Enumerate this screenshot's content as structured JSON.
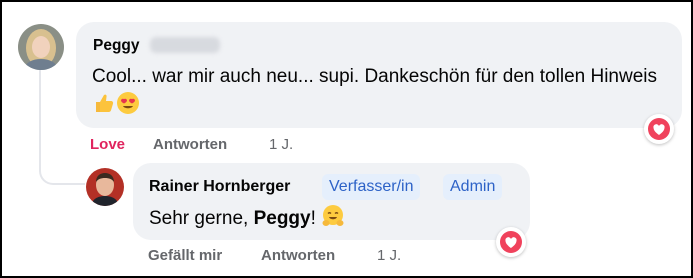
{
  "comments": [
    {
      "author": "Peggy",
      "text": "Cool... war mir auch neu... supi. Dankeschön für den tollen Hinweis",
      "emojis": [
        "thumbs-up-emoji",
        "smiling-face-with-heart-eyes-emoji"
      ],
      "actions": {
        "reaction_label": "Love",
        "reply_label": "Antworten",
        "time": "1 J."
      },
      "reaction_icon": "heart-icon",
      "colors": {
        "reaction_text": "#e0245e",
        "heart": "#f0425c"
      }
    },
    {
      "author": "Rainer Hornberger",
      "badges": [
        "Verfasser/in",
        "Admin"
      ],
      "text_before": "Sehr gerne, ",
      "mention": "Peggy",
      "text_after": "!",
      "emojis": [
        "hugging-face-emoji"
      ],
      "actions": {
        "like_label": "Gefällt mir",
        "reply_label": "Antworten",
        "time": "1 J."
      },
      "reaction_icon": "heart-icon",
      "colors": {
        "badge_bg": "#e5effc",
        "badge_text": "#2d62c7"
      }
    }
  ]
}
